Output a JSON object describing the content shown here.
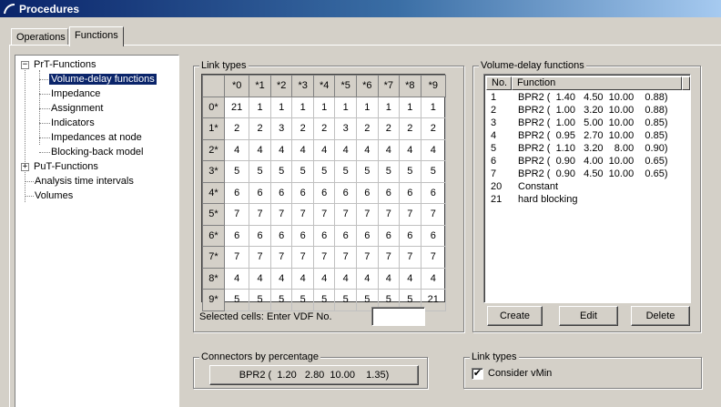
{
  "window": {
    "title": "Procedures"
  },
  "tabs": [
    {
      "label": "Operations",
      "active": false
    },
    {
      "label": "Functions",
      "active": true
    }
  ],
  "tree": {
    "prt_functions": "PrT-Functions",
    "items": [
      {
        "label": "Volume-delay functions",
        "selected": true
      },
      {
        "label": "Impedance"
      },
      {
        "label": "Assignment"
      },
      {
        "label": "Indicators"
      },
      {
        "label": "Impedances at node"
      },
      {
        "label": "Blocking-back model"
      }
    ],
    "put_functions": "PuT-Functions",
    "analysis_time_intervals": "Analysis time intervals",
    "volumes": "Volumes"
  },
  "link_types_group": {
    "title": "Link types",
    "col_headers": [
      "*0",
      "*1",
      "*2",
      "*3",
      "*4",
      "*5",
      "*6",
      "*7",
      "*8",
      "*9"
    ],
    "row_headers": [
      "0*",
      "1*",
      "2*",
      "3*",
      "4*",
      "5*",
      "6*",
      "7*",
      "8*",
      "9*"
    ],
    "rows": [
      [
        "21",
        "1",
        "1",
        "1",
        "1",
        "1",
        "1",
        "1",
        "1",
        "1"
      ],
      [
        "2",
        "2",
        "3",
        "2",
        "2",
        "3",
        "2",
        "2",
        "2",
        "2"
      ],
      [
        "4",
        "4",
        "4",
        "4",
        "4",
        "4",
        "4",
        "4",
        "4",
        "4"
      ],
      [
        "5",
        "5",
        "5",
        "5",
        "5",
        "5",
        "5",
        "5",
        "5",
        "5"
      ],
      [
        "6",
        "6",
        "6",
        "6",
        "6",
        "6",
        "6",
        "6",
        "6",
        "6"
      ],
      [
        "7",
        "7",
        "7",
        "7",
        "7",
        "7",
        "7",
        "7",
        "7",
        "7"
      ],
      [
        "6",
        "6",
        "6",
        "6",
        "6",
        "6",
        "6",
        "6",
        "6",
        "6"
      ],
      [
        "7",
        "7",
        "7",
        "7",
        "7",
        "7",
        "7",
        "7",
        "7",
        "7"
      ],
      [
        "4",
        "4",
        "4",
        "4",
        "4",
        "4",
        "4",
        "4",
        "4",
        "4"
      ],
      [
        "5",
        "5",
        "5",
        "5",
        "5",
        "5",
        "5",
        "5",
        "5",
        "21"
      ]
    ],
    "selected_cells_label": "Selected cells: Enter VDF No.",
    "selected_cells_value": ""
  },
  "vdf_group": {
    "title": "Volume-delay functions",
    "headers": {
      "no": "No.",
      "function": "Function"
    },
    "rows": [
      {
        "no": "1",
        "function": "BPR2 (  1.40   4.50  10.00    0.88)"
      },
      {
        "no": "2",
        "function": "BPR2 (  1.00   3.20  10.00    0.88)"
      },
      {
        "no": "3",
        "function": "BPR2 (  1.00   5.00  10.00    0.85)"
      },
      {
        "no": "4",
        "function": "BPR2 (  0.95   2.70  10.00    0.85)"
      },
      {
        "no": "5",
        "function": "BPR2 (  1.10   3.20    8.00    0.90)"
      },
      {
        "no": "6",
        "function": "BPR2 (  0.90   4.00  10.00    0.65)"
      },
      {
        "no": "7",
        "function": "BPR2 (  0.90   4.50  10.00    0.65)"
      },
      {
        "no": "20",
        "function": "Constant"
      },
      {
        "no": "21",
        "function": "hard blocking"
      }
    ],
    "buttons": {
      "create": "Create",
      "edit": "Edit",
      "delete": "Delete"
    }
  },
  "connectors_group": {
    "title": "Connectors by percentage",
    "button_label": "BPR2 (  1.20   2.80  10.00    1.35)"
  },
  "link_types_option_group": {
    "title": "Link types",
    "consider_vmin_label": "Consider vMin",
    "consider_vmin_checked": true
  }
}
